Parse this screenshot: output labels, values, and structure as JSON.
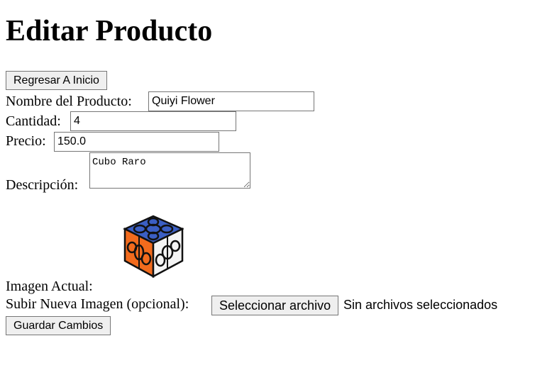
{
  "page": {
    "title": "Editar Producto"
  },
  "nav": {
    "back_button": "Regresar A Inicio"
  },
  "form": {
    "name_label": "Nombre del Producto:",
    "name_value": "Quiyi Flower",
    "quantity_label": "Cantidad:",
    "quantity_value": "4",
    "price_label": "Precio:",
    "price_value": "150.0",
    "description_label": "Descripción:",
    "description_value": "Cubo Raro",
    "current_image_label": "Imagen Actual:",
    "upload_label": "Subir Nueva Imagen (opcional):",
    "file_button": "Seleccionar archivo",
    "file_status": "Sin archivos seleccionados",
    "submit_button": "Guardar Cambios"
  },
  "image": {
    "icon": "flower-cube-image",
    "colors": [
      "#3b5fc4",
      "#f26b1d",
      "#ffffff",
      "#111111"
    ]
  }
}
